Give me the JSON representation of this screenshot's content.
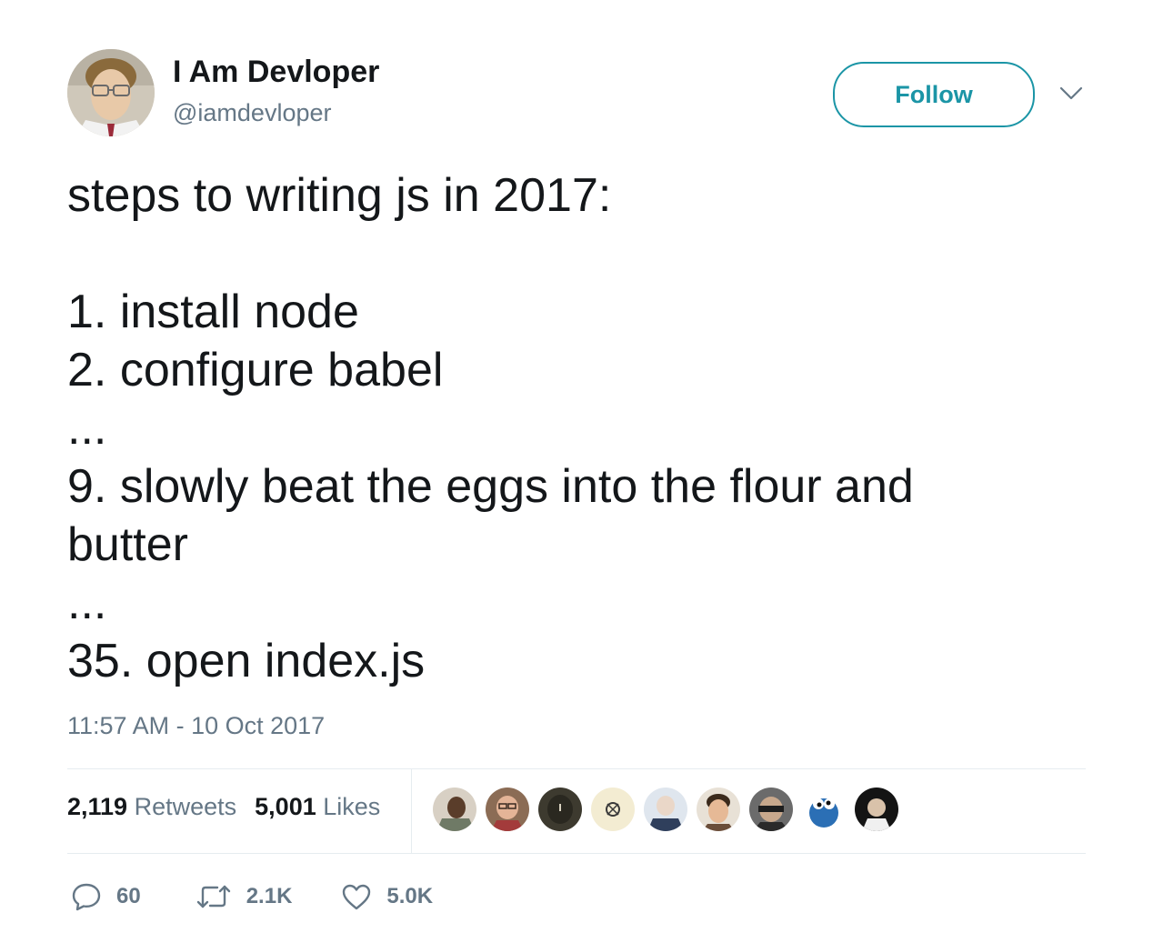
{
  "author": {
    "display_name": "I Am Devloper",
    "handle": "@iamdevloper"
  },
  "follow_button": {
    "label": "Follow"
  },
  "tweet": {
    "lines": [
      "steps to writing js in 2017:",
      "",
      "1. install node",
      "2. configure babel",
      "...",
      "9. slowly beat the eggs into the flour and",
      "butter",
      "...",
      "35. open index.js"
    ],
    "timestamp": "11:57 AM - 10 Oct 2017"
  },
  "stats": {
    "retweets_count": "2,119",
    "retweets_label": "Retweets",
    "likes_count": "5,001",
    "likes_label": "Likes"
  },
  "actions": {
    "reply_count": "60",
    "retweet_count": "2.1K",
    "like_count": "5.0K"
  },
  "colors": {
    "accent": "#1b95a6",
    "secondary_text": "#657786",
    "primary_text": "#14171a",
    "divider": "#e6ecf0"
  },
  "icons": [
    "chevron-down-icon",
    "reply-icon",
    "retweet-icon",
    "heart-icon"
  ]
}
